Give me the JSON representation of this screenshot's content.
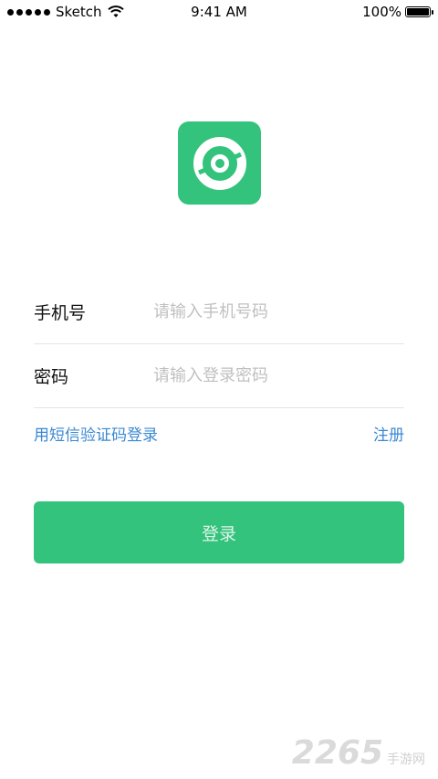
{
  "status_bar": {
    "carrier": "Sketch",
    "time": "9:41 AM",
    "battery": "100%",
    "battery_level": 1.0
  },
  "logo": {
    "icon": "app-logo-icon",
    "color": "#33c37c"
  },
  "form": {
    "phone": {
      "label": "手机号",
      "placeholder": "请输入手机号码",
      "value": ""
    },
    "password": {
      "label": "密码",
      "placeholder": "请输入登录密码",
      "value": ""
    }
  },
  "links": {
    "sms_login": "用短信验证码登录",
    "register": "注册",
    "color": "#3a88d2"
  },
  "login_button": {
    "label": "登录",
    "color": "#33c37c"
  },
  "watermark": {
    "number": "2265",
    "text": "手游网"
  }
}
